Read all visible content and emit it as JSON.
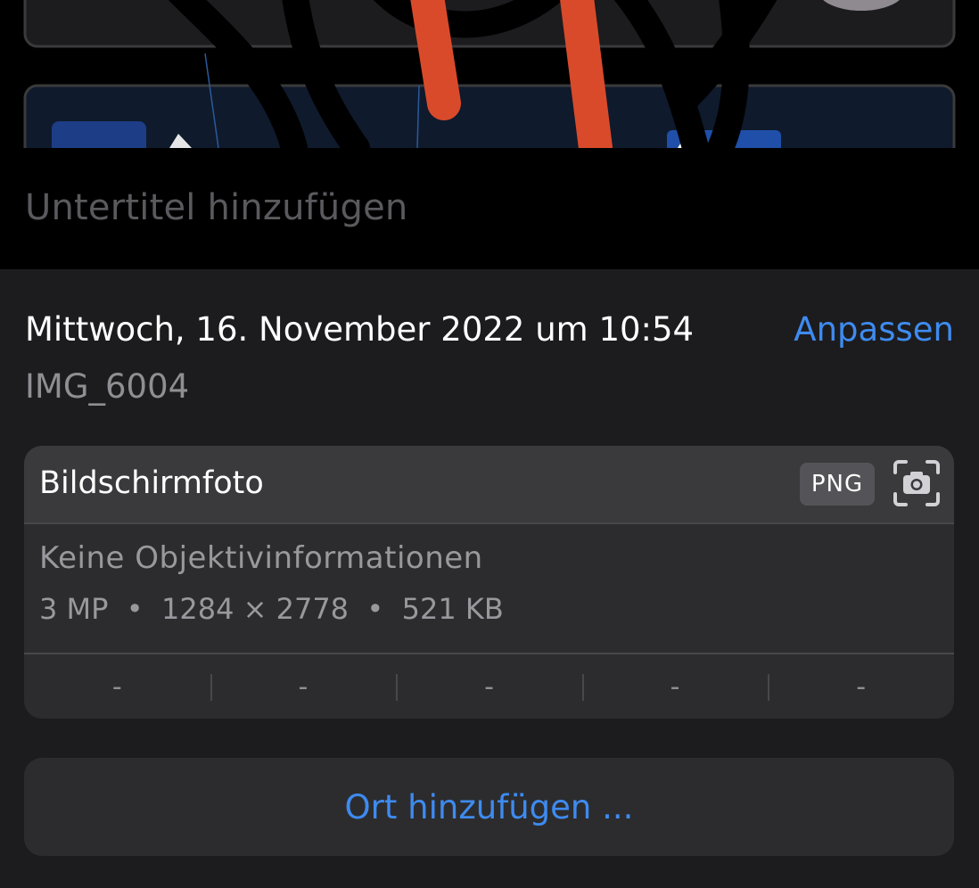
{
  "caption": {
    "placeholder": "Untertitel hinzufügen"
  },
  "info": {
    "date": "Mittwoch, 16. November 2022 um 10:54",
    "adjust_label": "Anpassen",
    "filename": "IMG_6004"
  },
  "metadata": {
    "title": "Bildschirmfoto",
    "format": "PNG",
    "camera_icon": "screenshot-camera-icon",
    "lens": "Keine Objektivinformationen",
    "megapixels": "3 MP",
    "resolution": "1284 × 2778",
    "filesize": "521 KB",
    "separator": "•",
    "exif": [
      "-",
      "-",
      "-",
      "-",
      "-"
    ]
  },
  "location": {
    "add_label": "Ort hinzufügen ..."
  },
  "colors": {
    "accent": "#3e8bf0",
    "panel_bg": "#1c1c1e",
    "card_bg": "#2c2c2e",
    "header_bg": "#3a3a3c",
    "secondary_text": "#8e8e93",
    "photo_stroke_orange": "#d94a2b"
  }
}
